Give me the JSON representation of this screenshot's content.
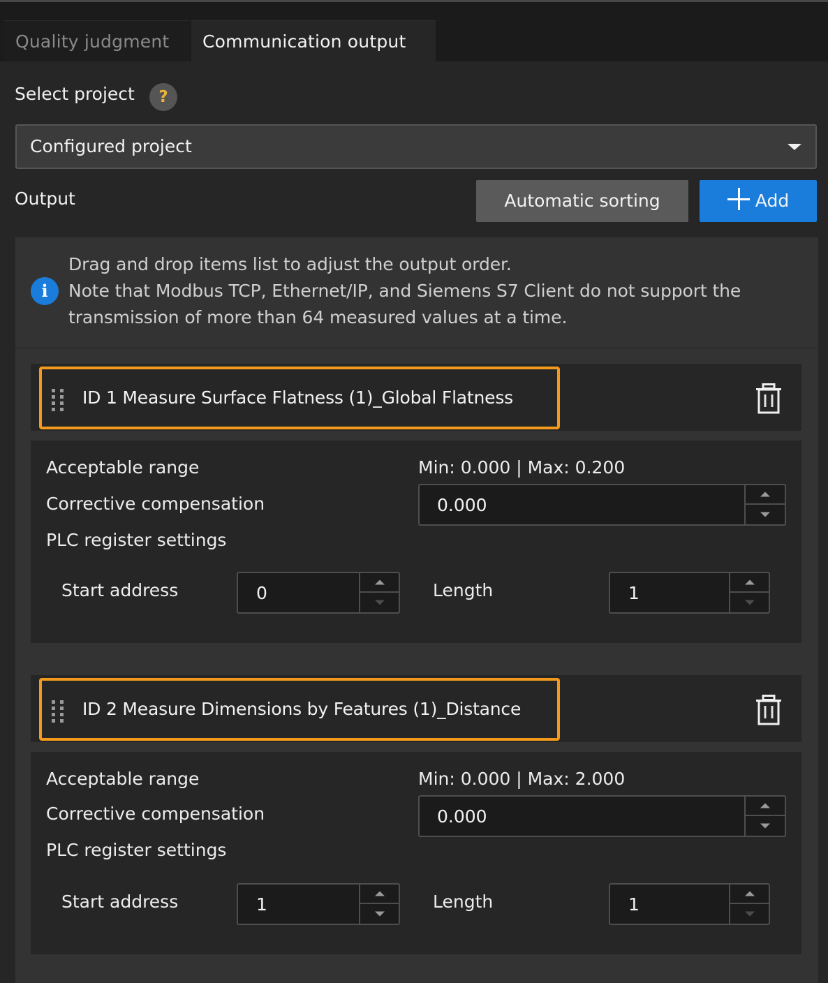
{
  "tabs": [
    {
      "label": "Quality judgment",
      "active": false
    },
    {
      "label": "Communication output",
      "active": true
    }
  ],
  "select_project": {
    "label": "Select project",
    "help_icon": "question-mark-icon",
    "value": "Configured project"
  },
  "output": {
    "label": "Output",
    "sort_button": "Automatic sorting",
    "add_button": "Add"
  },
  "info": {
    "icon": "info-icon",
    "lines": [
      "Drag and drop items list to adjust the output order.",
      "Note that Modbus TCP, Ethernet/IP, and Siemens S7 Client do not support the",
      "transmission of more than 64 measured values at a time."
    ]
  },
  "items": [
    {
      "title": "ID 1  Measure Surface Flatness (1)_Global Flatness",
      "acceptable_range_label": "Acceptable range",
      "range": "Min: 0.000 | Max: 0.200",
      "compensation_label": "Corrective compensation",
      "compensation": "0.000",
      "plc_label": "PLC register settings",
      "start_address_label": "Start address",
      "start_address": "0",
      "length_label": "Length",
      "length": "1"
    },
    {
      "title": "ID 2  Measure Dimensions by Features (1)_Distance",
      "acceptable_range_label": "Acceptable range",
      "range": "Min: 0.000 | Max: 2.000",
      "compensation_label": "Corrective compensation",
      "compensation": "0.000",
      "plc_label": "PLC register settings",
      "start_address_label": "Start address",
      "start_address": "1",
      "length_label": "Length",
      "length": "1"
    }
  ],
  "colors": {
    "accent_blue": "#1a7ddc",
    "highlight_orange": "#f39a1c",
    "help_yellow": "#e8b43a"
  }
}
